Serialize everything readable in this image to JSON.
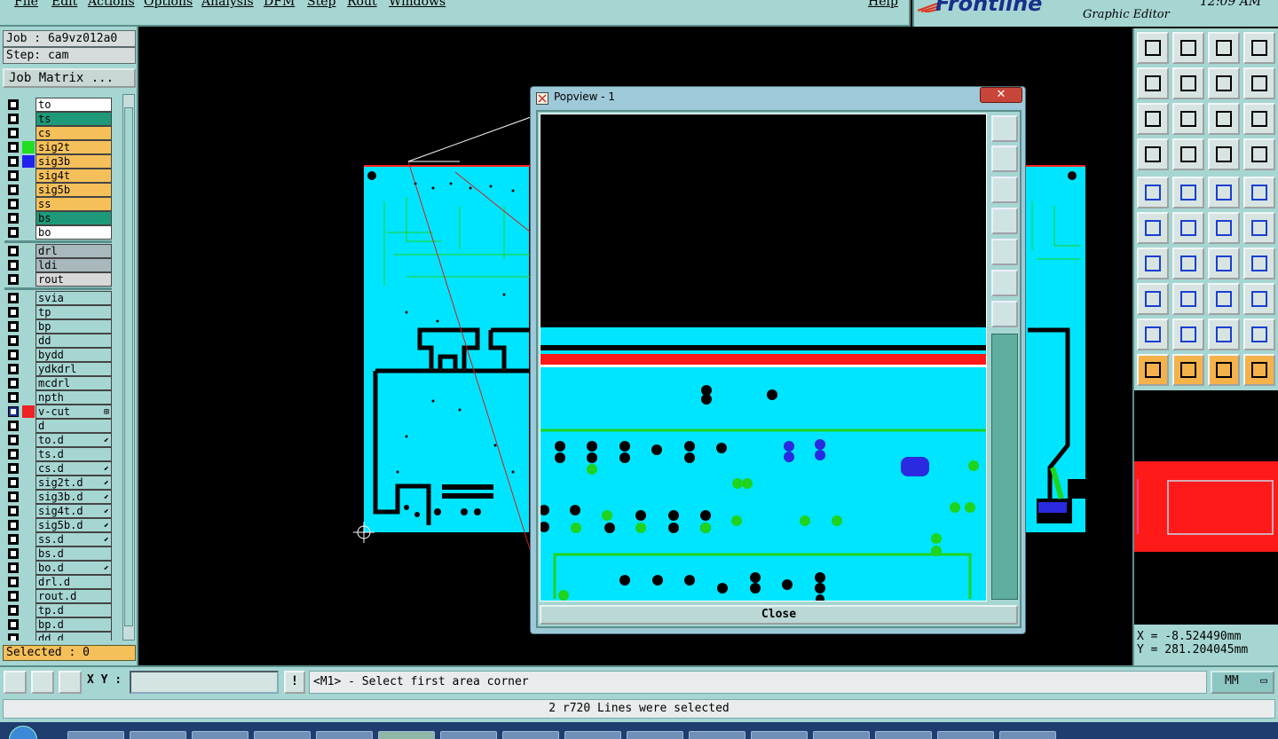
{
  "menubar": {
    "items": [
      "File",
      "Edit",
      "Actions",
      "Options",
      "Analysis",
      "DFM",
      "Step",
      "Rout",
      "Windows"
    ],
    "help": "Help"
  },
  "brand": {
    "logo": "Frontline",
    "subtitle": "Graphic Editor",
    "clock": "12:09 AM"
  },
  "info": {
    "job": "Job : 6a9vz012a0",
    "step": "Step: cam",
    "job_matrix": "Job Matrix ..."
  },
  "layers": [
    {
      "name": "to",
      "bg": "#ffffff",
      "color": null
    },
    {
      "name": "ts",
      "bg": "#1e9a7a",
      "color": null
    },
    {
      "name": "cs",
      "bg": "#f5c05a",
      "color": null
    },
    {
      "name": "sig2t",
      "bg": "#f5c05a",
      "color": "#22dd22"
    },
    {
      "name": "sig3b",
      "bg": "#f5c05a",
      "color": "#2222ee"
    },
    {
      "name": "sig4t",
      "bg": "#f5c05a",
      "color": null
    },
    {
      "name": "sig5b",
      "bg": "#f5c05a",
      "color": null
    },
    {
      "name": "ss",
      "bg": "#f5c05a",
      "color": null
    },
    {
      "name": "bs",
      "bg": "#1e9a7a",
      "color": null
    },
    {
      "name": "bo",
      "bg": "#ffffff",
      "color": null
    },
    {
      "sep": true
    },
    {
      "name": "drl",
      "bg": "#a8b8bc",
      "color": null
    },
    {
      "name": "ldi",
      "bg": "#a8b8bc",
      "color": null
    },
    {
      "name": "rout",
      "bg": "#d8d8d8",
      "color": null
    },
    {
      "sep": true
    },
    {
      "name": "svia",
      "bg": "#a6d6d2",
      "color": null
    },
    {
      "name": "tp",
      "bg": "#a6d6d2",
      "color": null
    },
    {
      "name": "bp",
      "bg": "#a6d6d2",
      "color": null
    },
    {
      "name": "dd",
      "bg": "#a6d6d2",
      "color": null
    },
    {
      "name": "bydd",
      "bg": "#a6d6d2",
      "color": null
    },
    {
      "name": "ydkdrl",
      "bg": "#a6d6d2",
      "color": null
    },
    {
      "name": "mcdrl",
      "bg": "#a6d6d2",
      "color": null
    },
    {
      "name": "npth",
      "bg": "#a6d6d2",
      "color": null
    },
    {
      "name": "v-cut",
      "bg": "#a6d6d2",
      "color": "#ee2222",
      "mark": "⊞",
      "active": true
    },
    {
      "name": "d",
      "bg": "#a6d6d2",
      "color": null
    },
    {
      "name": "to.d",
      "bg": "#a6d6d2",
      "color": null,
      "mark": "⬋"
    },
    {
      "name": "ts.d",
      "bg": "#a6d6d2",
      "color": null
    },
    {
      "name": "cs.d",
      "bg": "#a6d6d2",
      "color": null,
      "mark": "⬋"
    },
    {
      "name": "sig2t.d",
      "bg": "#a6d6d2",
      "color": null,
      "mark": "⬋"
    },
    {
      "name": "sig3b.d",
      "bg": "#a6d6d2",
      "color": null,
      "mark": "⬋"
    },
    {
      "name": "sig4t.d",
      "bg": "#a6d6d2",
      "color": null,
      "mark": "⬋"
    },
    {
      "name": "sig5b.d",
      "bg": "#a6d6d2",
      "color": null,
      "mark": "⬋"
    },
    {
      "name": "ss.d",
      "bg": "#a6d6d2",
      "color": null,
      "mark": "⬋"
    },
    {
      "name": "bs.d",
      "bg": "#a6d6d2",
      "color": null
    },
    {
      "name": "bo.d",
      "bg": "#a6d6d2",
      "color": null,
      "mark": "⬋"
    },
    {
      "name": "drl.d",
      "bg": "#a6d6d2",
      "color": null
    },
    {
      "name": "rout.d",
      "bg": "#a6d6d2",
      "color": null
    },
    {
      "name": "tp.d",
      "bg": "#a6d6d2",
      "color": null
    },
    {
      "name": "bp.d",
      "bg": "#a6d6d2",
      "color": null
    },
    {
      "name": "dd.d",
      "bg": "#a6d6d2",
      "color": null
    }
  ],
  "selected": "Selected : 0",
  "popview": {
    "title": "Popview - 1",
    "close_x": "✕",
    "close_button": "Close"
  },
  "coords": {
    "x": "X = -8.524490mm",
    "y": "Y = 281.204045mm"
  },
  "cmdbar": {
    "xy_label": "X Y :",
    "xy_value": "",
    "excl": "!",
    "prompt": "<M1> - Select first area corner",
    "unit": "MM"
  },
  "status": "2 r720 Lines were selected",
  "colors": {
    "panel": "#a6d6d2",
    "board": "#00e5ff",
    "highlight": "#ff1a1a",
    "orange": "#f5b24a"
  }
}
